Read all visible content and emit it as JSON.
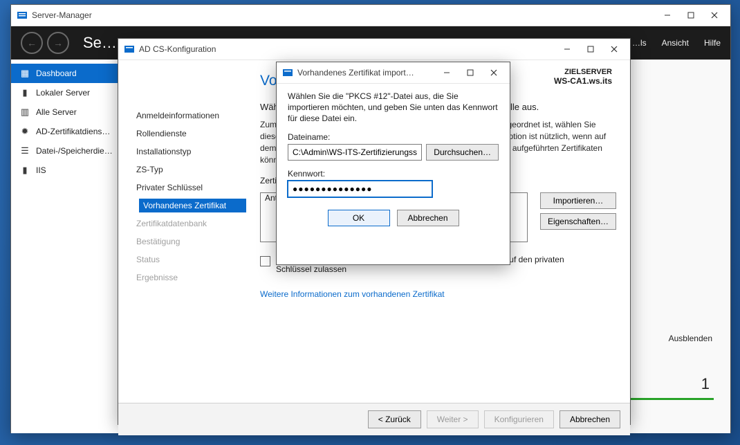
{
  "server_manager": {
    "title": "Server-Manager",
    "breadcrumb": "Se…",
    "menu": [
      "…ls",
      "Ansicht",
      "Hilfe"
    ],
    "sidebar": [
      {
        "label": "Dashboard",
        "icon": "dashboard"
      },
      {
        "label": "Lokaler Server",
        "icon": "server"
      },
      {
        "label": "Alle Server",
        "icon": "servers"
      },
      {
        "label": "AD-Zertifikatdiens…",
        "icon": "cert"
      },
      {
        "label": "Datei-/Speicherdie…",
        "icon": "storage"
      },
      {
        "label": "IIS",
        "icon": "iis"
      }
    ],
    "hide_label": "Ausblenden",
    "count": "1"
  },
  "wizard": {
    "title": "AD CS-Konfiguration",
    "heading": "Vorhandenes Zertifikat",
    "dest_label": "ZIELSERVER",
    "dest_value": "WS-CA1.ws.its",
    "steps": [
      {
        "label": "Anmeldeinformationen"
      },
      {
        "label": "Rollendienste"
      },
      {
        "label": "Installationstyp"
      },
      {
        "label": "ZS-Typ"
      },
      {
        "label": "Privater Schlüssel"
      },
      {
        "label": "Vorhandenes Zertifikat",
        "sel": true
      },
      {
        "label": "Zertifikatdatenbank",
        "dis": true
      },
      {
        "label": "Bestätigung",
        "dis": true
      },
      {
        "label": "Status",
        "dis": true
      },
      {
        "label": "Ergebnisse",
        "dis": true
      }
    ],
    "sec_heading": "Wählen Sie ein vorhandenes Zertifikat für die Zertifizierungsstelle aus.",
    "para": "Zum Auswählen eines Zertifikats, das dieser Zertifizierungsstelle zugeordnet ist, wählen Sie dieses Zertifikat aus der Liste aus, oder importieren Sie es. Diese Option ist nützlich, wenn auf dem Zielcomputer kein Zertifikat installiert ist. Informationen zu allen aufgeführten Zertifikaten können angezeigt werden, wenn Sie auf \"Eigenschaften\" klicken.",
    "list_label": "Zertifikate:",
    "list_value": "Ant…",
    "btn_import": "Importieren…",
    "btn_props": "Eigenschaften…",
    "chk_label": "Administratorinteraktion bei jedem Zertifizierungsstellenzugriff auf den privaten Schlüssel zulassen",
    "link": "Weitere Informationen zum vorhandenen Zertifikat",
    "foot": {
      "back": "< Zurück",
      "next": "Weiter >",
      "cfg": "Konfigurieren",
      "cancel": "Abbrechen"
    }
  },
  "import": {
    "title": "Vorhandenes Zertifikat import…",
    "intro": "Wählen Sie die \"PKCS #12\"-Datei aus, die Sie importieren möchten, und geben Sie unten das Kennwort für diese Datei ein.",
    "file_label": "Dateiname:",
    "file_value": "C:\\Admin\\WS-ITS-Zertifizierungsstel",
    "browse": "Durchsuchen…",
    "pw_label": "Kennwort:",
    "pw_value": "●●●●●●●●●●●●●●",
    "ok": "OK",
    "cancel": "Abbrechen"
  }
}
